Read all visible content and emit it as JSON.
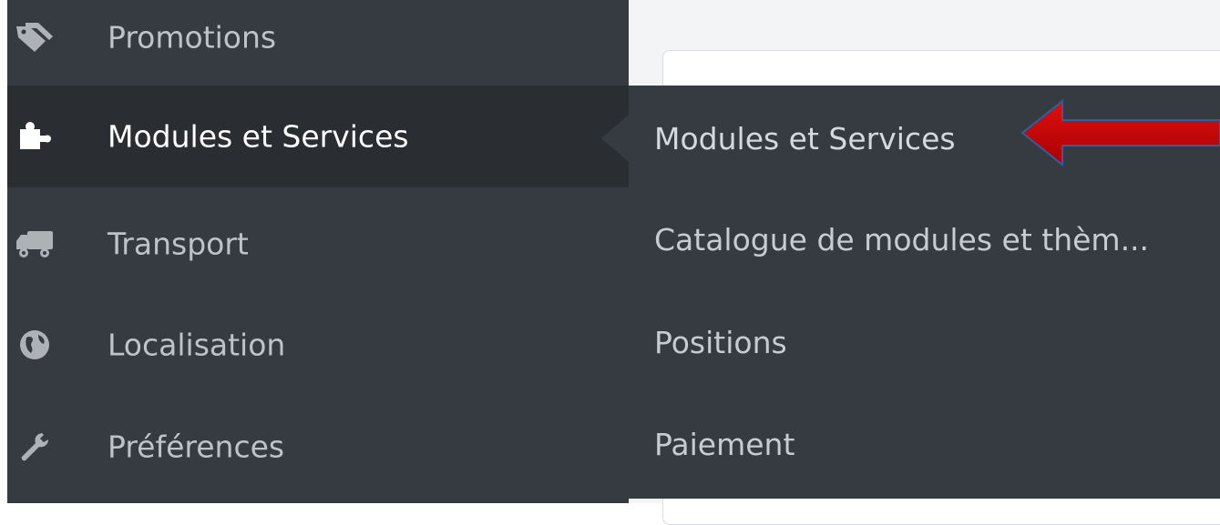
{
  "sidebar": {
    "items": [
      {
        "label": "Promotions",
        "icon": "tag-icon"
      },
      {
        "label": "Modules et Services",
        "icon": "puzzle-icon",
        "active": true
      },
      {
        "label": "Transport",
        "icon": "truck-icon"
      },
      {
        "label": "Localisation",
        "icon": "globe-icon"
      },
      {
        "label": "Préférences",
        "icon": "wrench-icon"
      }
    ]
  },
  "submenu": {
    "items": [
      {
        "label": "Modules et Services",
        "active": true
      },
      {
        "label": "Catalogue de modules et thèm..."
      },
      {
        "label": "Positions"
      },
      {
        "label": "Paiement"
      }
    ]
  },
  "colors": {
    "sidebar_bg": "#363a41",
    "active_bg": "#2a2d32",
    "arrow": "#c00000",
    "arrow_outline": "#2e5f9e"
  }
}
